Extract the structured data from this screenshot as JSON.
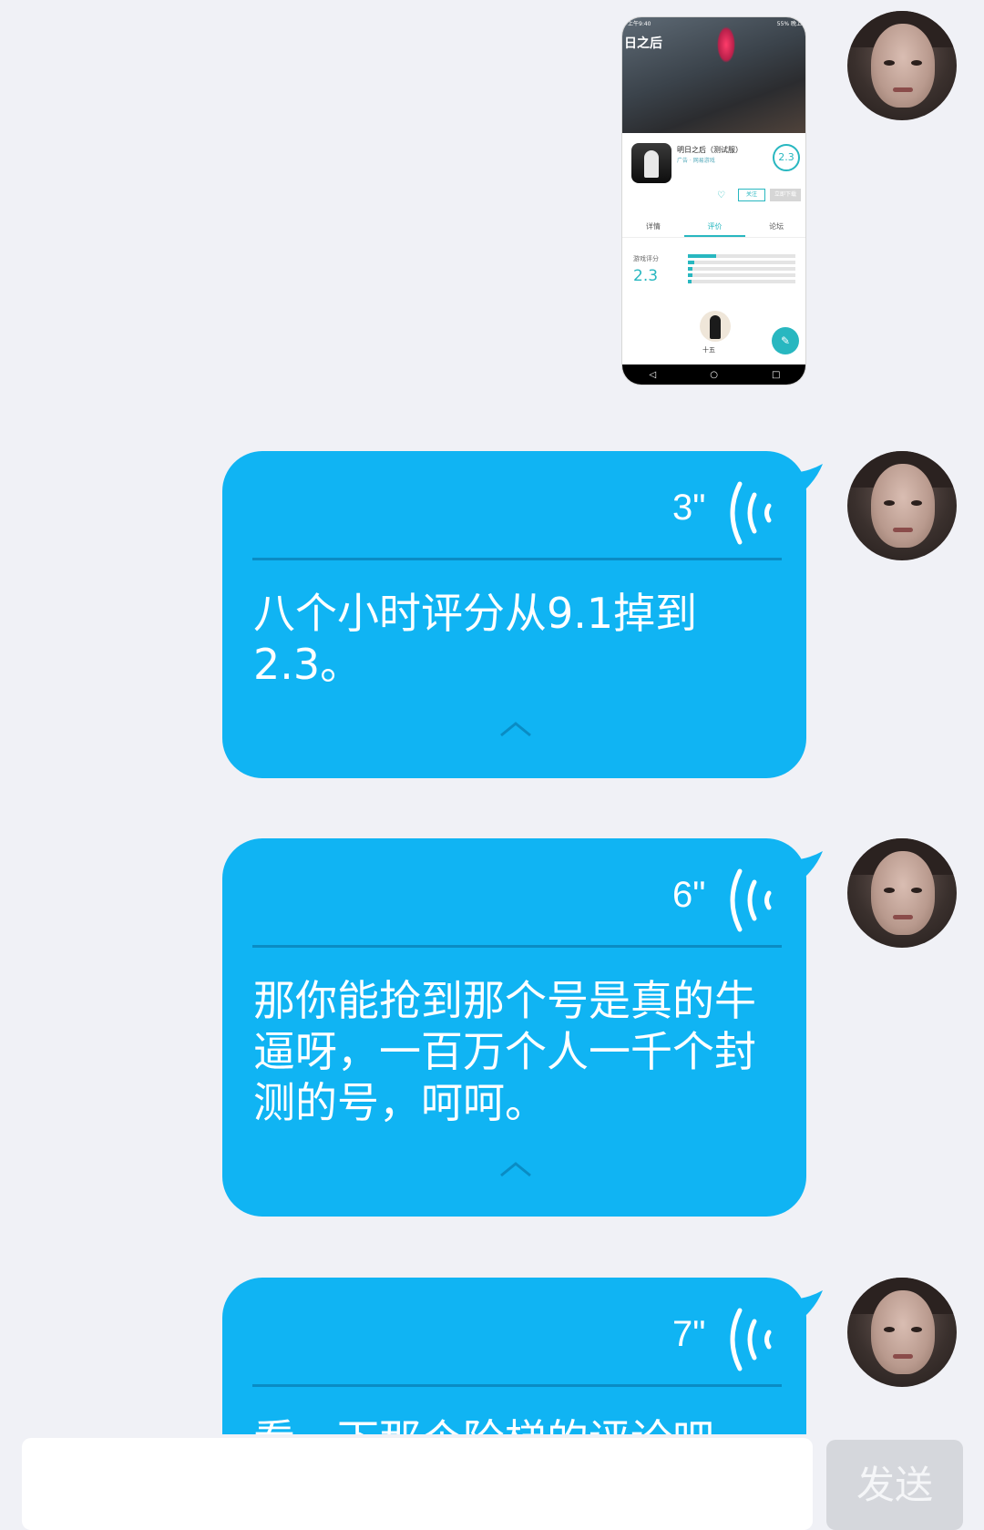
{
  "thumbnail": {
    "status_left": "上午9:40",
    "status_right": "55% 晚上",
    "hero_logo": "日之后",
    "app_title": "明日之后（测试服）",
    "app_sub": "广告 · 网易游戏",
    "score": "2.3",
    "follow_label": "关注",
    "download_label": "立即下载",
    "tabs": [
      "详情",
      "评价",
      "论坛"
    ],
    "rating_label": "游戏评分",
    "rating_value": "2.3",
    "username": "十五",
    "fab_icon": "pencil-icon",
    "nav": [
      "◁",
      "○",
      "□"
    ]
  },
  "messages": [
    {
      "duration": "3\"",
      "text": "八个小时评分从9.1掉到2.3。"
    },
    {
      "duration": "6\"",
      "text": "那你能抢到那个号是真的牛逼呀，一百万个人一千个封测的号，呵呵。"
    },
    {
      "duration": "7\"",
      "text": "看一下那个阶梯的评论吧"
    }
  ],
  "input": {
    "value": "",
    "placeholder": ""
  },
  "send_label": "发送",
  "colors": {
    "bubble": "#10b4f3",
    "background": "#f0f1f6",
    "send_disabled": "#d5d7dc",
    "accent": "#28b7c0"
  }
}
